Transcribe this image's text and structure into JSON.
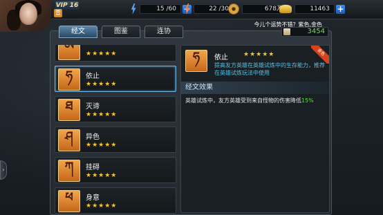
{
  "player": {
    "vip": "VIP 16",
    "level_badge": "壹"
  },
  "stats": {
    "energy": "15 /60",
    "stamina": "22 /30",
    "coins": "678万",
    "gold": "11463"
  },
  "marquee": "今儿个运势不错？紫色,金色",
  "tabs": [
    {
      "label": "经文",
      "active": true
    },
    {
      "label": "图鉴",
      "active": false
    },
    {
      "label": "连协",
      "active": false
    }
  ],
  "points": "3454",
  "list": [
    {
      "name": "",
      "stars": "★★★★★",
      "glyph": "ཨ"
    },
    {
      "name": "依止",
      "stars": "★★★★★",
      "glyph": "ཧ",
      "selected": true
    },
    {
      "name": "灭谛",
      "stars": "★★★★★",
      "glyph": "ཐ"
    },
    {
      "name": "异色",
      "stars": "★★★★★",
      "glyph": "ཤ"
    },
    {
      "name": "挂碍",
      "stars": "★★★★★",
      "glyph": "ཀ"
    },
    {
      "name": "身意",
      "stars": "★★★★★",
      "glyph": "ཕ"
    }
  ],
  "detail": {
    "name": "依止",
    "stars": "★★★★★",
    "ribbon": "金色",
    "glyph": "ཧ",
    "desc": "提高友方英雄在英雄试炼中的生存能力，推荐在英雄试炼玩法中使用",
    "effect_title": "经文效果",
    "effect_text": "英雄试炼中，友方英雄受到来自怪物的伤害降低",
    "effect_pct": "15%"
  },
  "colors": {
    "accent_blue": "#4fc3e8",
    "star": "#f6c531",
    "green": "#5ce04a"
  }
}
